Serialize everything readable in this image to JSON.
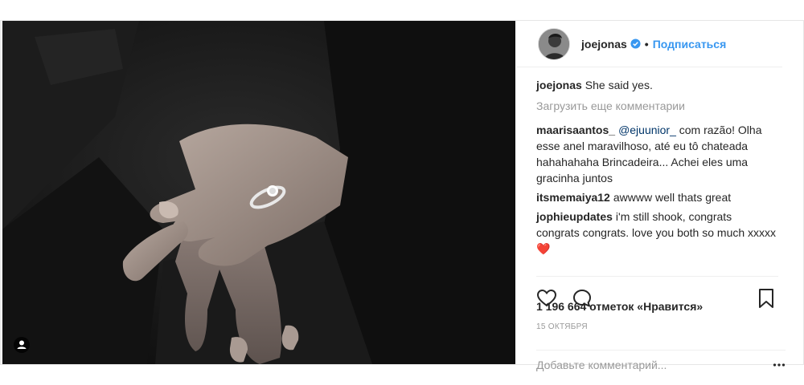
{
  "post": {
    "photo": {
      "description_icon": "user-tag-icon"
    },
    "header": {
      "username": "joejonas",
      "verified_icon": "verified-badge-icon",
      "separator": "•",
      "follow_label": "Подписаться"
    },
    "caption": {
      "author": "joejonas",
      "text": "She said yes."
    },
    "load_more_label": "Загрузить еще комментарии",
    "comments": [
      {
        "author": "maarisaantos_",
        "mention": "@ejuunior_",
        "text": " com razão! Olha esse anel maravilhoso, até eu tô chateada hahahahaha Brincadeira... Achei eles uma gracinha juntos"
      },
      {
        "author": "itsmemaiya12",
        "mention": "",
        "text": "awwww well thats great"
      },
      {
        "author": "jophieupdates",
        "mention": "",
        "text": "i'm still shook, congrats congrats congrats. love you both so much xxxxx ",
        "emoji": "❤️"
      }
    ],
    "actions": {
      "like_icon": "heart-outline-icon",
      "comment_icon": "speech-bubble-icon",
      "save_icon": "bookmark-icon"
    },
    "likes_text": "1 196 664 отметок «Нравится»",
    "date_text": "15 ОКТЯБРЯ",
    "add_comment": {
      "placeholder": "Добавьте комментарий...",
      "more_icon": "ellipsis-icon"
    },
    "colors": {
      "link": "#3897f0",
      "muted": "#999999",
      "text": "#262626",
      "verified": "#3897f0",
      "heart": "#e0245e"
    }
  }
}
